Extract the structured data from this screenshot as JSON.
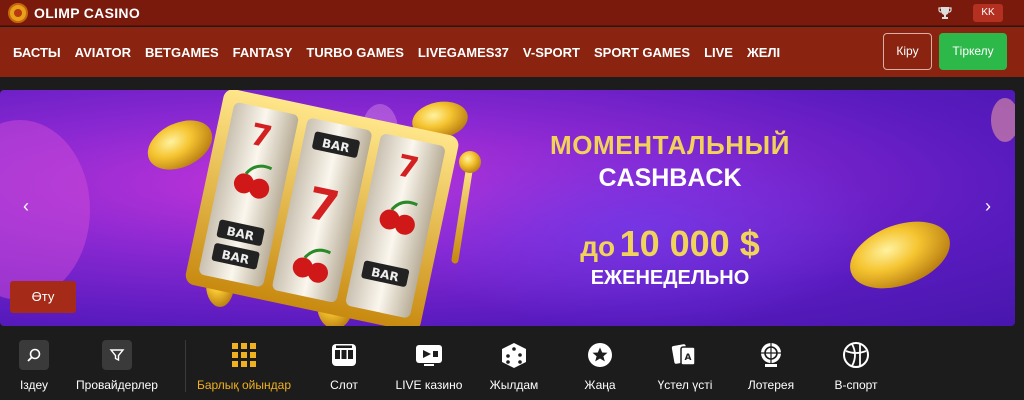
{
  "header": {
    "brand": "OLIMP CASINO",
    "language": "KK",
    "icons": [
      "olimp-logo-icon",
      "trophy-icon"
    ]
  },
  "nav": {
    "items": [
      "БАСТЫ",
      "AVIATOR",
      "BETGAMES",
      "FANTASY",
      "TURBO GAMES",
      "LIVEGAMES37",
      "V-SPORT",
      "SPORT GAMES",
      "LIVE",
      "ЖЕЛІ"
    ],
    "login_label": "Кіру",
    "register_label": "Тіркелу"
  },
  "banner": {
    "line1": "МОМЕНТАЛЬНЫЙ",
    "line2": "CASHBACK",
    "line3_prefix": "до",
    "line3_amount": "10 000 $",
    "line4": "ЕЖЕНЕДЕЛЬНО",
    "go_label": "Өту",
    "reel_text": "BAR"
  },
  "categories": [
    {
      "label": "Іздеу",
      "icon": "search-icon"
    },
    {
      "label": "Провайдерлер",
      "icon": "filter-icon"
    },
    {
      "label": "Барлық ойындар",
      "icon": "grid-icon",
      "active": true
    },
    {
      "label": "Слот",
      "icon": "slot-machine-icon"
    },
    {
      "label": "LIVE казино",
      "icon": "live-camera-icon"
    },
    {
      "label": "Жылдам",
      "icon": "dice-icon"
    },
    {
      "label": "Жаңа",
      "icon": "star-icon"
    },
    {
      "label": "Үстел үсті",
      "icon": "table-cards-icon"
    },
    {
      "label": "Лотерея",
      "icon": "lottery-wheel-icon"
    },
    {
      "label": "В-спорт",
      "icon": "sport-ball-icon"
    }
  ],
  "colors": {
    "topbar": "#7a1a0c",
    "navbar": "#8a2410",
    "register": "#2db84a",
    "accent": "#f0b020",
    "banner": "#5a1bbf"
  }
}
